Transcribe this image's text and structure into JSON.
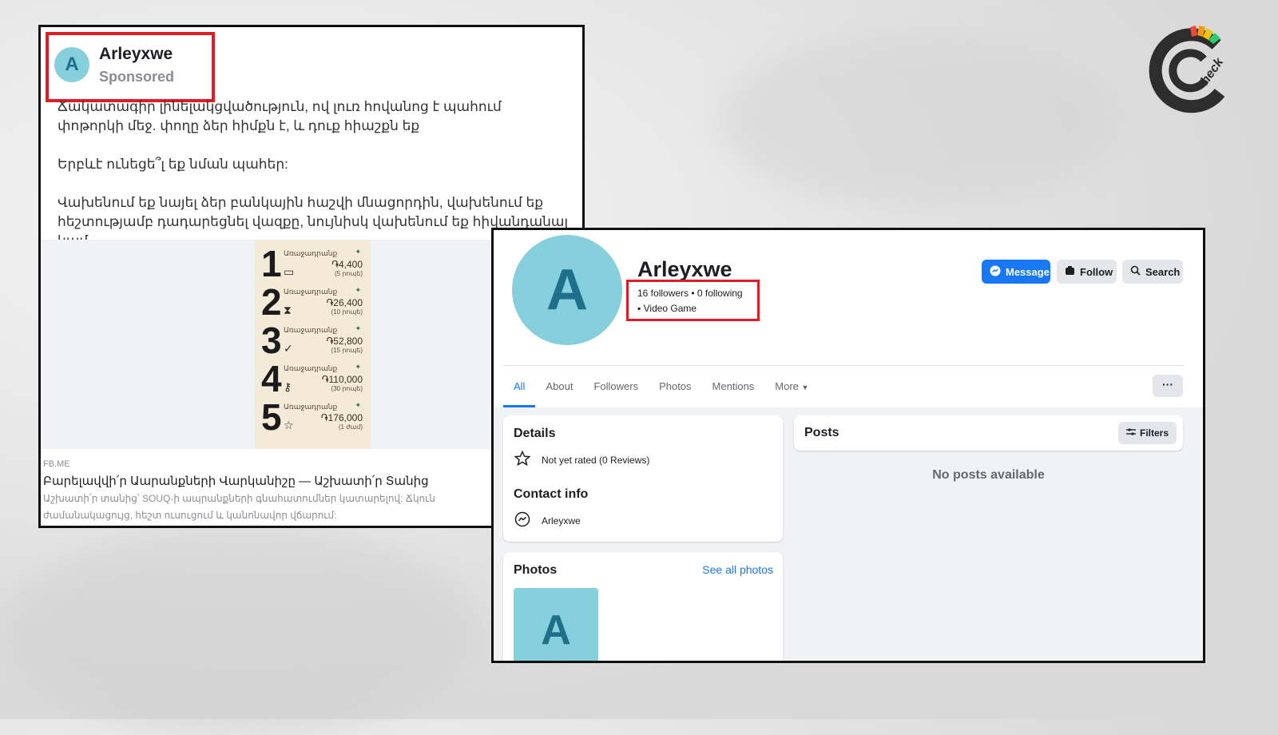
{
  "ad": {
    "page_name": "Arleyxwe",
    "avatar_letter": "A",
    "sponsored_label": "Sponsored",
    "body_lines": [
      "Ճակատագիր լինելակցվածություն, ով լուռ հովանոց է պահում փոթորկի մեջ. փողը ձեր հիմքն է, և դուք հիաշքն եք",
      "Երբևէ ունեցե՞լ եք նման պահեր:",
      "Վախենում եք նայել ձեր բանկային հաշվի մնացորդին, վախենում եք հեշտությամբ դադարեցնել վազքը, նույնիսկ վախենում եք հիվանդանալ կամ..."
    ],
    "poster_items": [
      {
        "num": "1",
        "label": "Առաջադրանք",
        "price": "֏4,400",
        "sub": "(5 րոպե)",
        "icon": "wallet-icon"
      },
      {
        "num": "2",
        "label": "Առաջադրանք",
        "price": "֏26,400",
        "sub": "(10 րոպե)",
        "icon": "hourglass-icon"
      },
      {
        "num": "3",
        "label": "Առաջադրանք",
        "price": "֏52,800",
        "sub": "(15 րոպե)",
        "icon": "check-icon"
      },
      {
        "num": "4",
        "label": "Առաջադրանք",
        "price": "֏110,000",
        "sub": "(30 րոպե)",
        "icon": "key-icon"
      },
      {
        "num": "5",
        "label": "Առաջադրանք",
        "price": "֏176,000",
        "sub": "(1 ժամ)",
        "icon": "star-icon"
      }
    ],
    "link_domain": "FB.ME",
    "link_title": "Բարելավվի՛ր Աարանքների Վարկանիշը — Աշխատի՛ր Տանից",
    "link_desc_lines": [
      "Աշխատի՛ր տանից՝ SOUQ-ի ապրանքների գնահատումներ կատարելով: Ճկուն",
      "ժամանակացույց, հեշտ ուսուցում և կանոնավոր վճարում:"
    ]
  },
  "profile": {
    "name": "Arleyxwe",
    "avatar_letter": "A",
    "followers_text": "16 followers • 0 following",
    "category": "Video Game",
    "buttons": {
      "message": "Message",
      "follow": "Follow",
      "search": "Search"
    },
    "tabs": [
      "All",
      "About",
      "Followers",
      "Photos",
      "Mentions",
      "More"
    ],
    "more_menu": "···",
    "details": {
      "title": "Details",
      "rating": "Not yet rated (0 Reviews)",
      "contact_title": "Contact info",
      "contact": "Arleyxwe"
    },
    "photos": {
      "title": "Photos",
      "see_all": "See all photos",
      "thumb_letter": "A"
    },
    "posts": {
      "title": "Posts",
      "filters": "Filters",
      "empty": "No posts available"
    }
  },
  "colors": {
    "accent": "#1877f2",
    "highlight": "#e01b24",
    "avatar_bg": "#86cfdc",
    "avatar_fg": "#1f6f8b"
  }
}
